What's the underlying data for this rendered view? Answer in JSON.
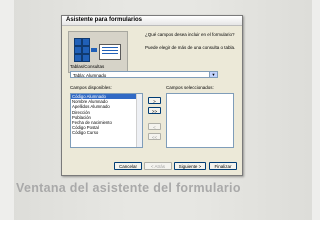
{
  "window": {
    "title": "Asistente para formularios"
  },
  "intro": {
    "question": "¿Qué campos desea incluir en el formulario?",
    "hint": "Puede elegir de más de una consulta o tabla."
  },
  "tables": {
    "label": "Tablas/Consultas",
    "selected": "Tabla: Alumnado"
  },
  "available": {
    "label": "Campos disponibles:",
    "items": [
      "Código Alumnado",
      "Nombre Alumnado",
      "Apellidos Alumnado",
      "Dirección",
      "Población",
      "Fecha de nacimiento",
      "Código Postal",
      "Código Curso"
    ]
  },
  "selected_fields": {
    "label": "Campos seleccionados:"
  },
  "move_buttons": [
    ">",
    ">>",
    "<",
    "<<"
  ],
  "buttons": {
    "cancel": "Cancelar",
    "back": "< Atrás",
    "next": "Siguiente >",
    "finish": "Finalizar"
  },
  "caption": "Ventana del asistente del formulario"
}
